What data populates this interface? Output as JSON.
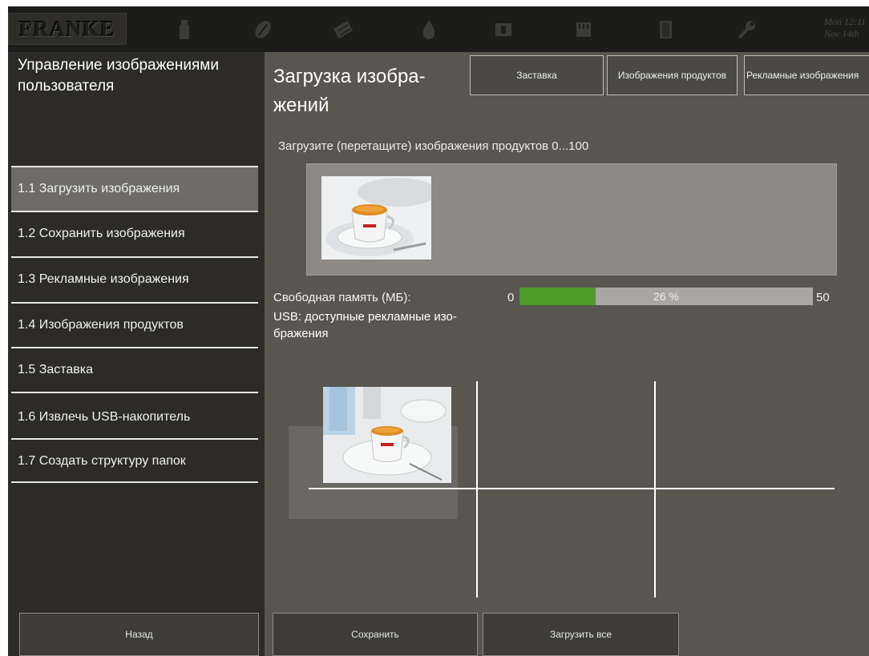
{
  "header": {
    "logo_text": "FRANKE",
    "icons": [
      "product-bag-icon",
      "coffee-bean-icon",
      "chocolate-icon",
      "water-drop-icon",
      "cup-icon",
      "cup-holder-icon",
      "door-icon",
      "wrench-icon"
    ],
    "datetime_line1": "Mon 12:11",
    "datetime_line2": "Nov 14th"
  },
  "sidebar": {
    "title": "Управление изображениями пользователя",
    "items": [
      {
        "label": "1.1 Загрузить изображения",
        "active": true
      },
      {
        "label": "1.2 Сохранить изображения",
        "active": false
      },
      {
        "label": "1.3 Рекламные изображения",
        "active": false
      },
      {
        "label": "1.4 Изображения продуктов",
        "active": false
      },
      {
        "label": "1.5 Заставка",
        "active": false
      },
      {
        "label": "1.6 Извлечь USB-накопитель",
        "active": false
      },
      {
        "label": "1.7 Создать структуру папок",
        "active": false
      }
    ],
    "back_label": "Назад"
  },
  "main": {
    "title_line1": "Загрузка изобра-",
    "title_line2": "жений",
    "tabs": [
      {
        "label": "Заставка"
      },
      {
        "label": "Изображения продуктов"
      },
      {
        "label": "Рекламные изображения"
      }
    ],
    "hint": "Загрузите (перетащите) изображения продуктов 0...100",
    "memory": {
      "label": "Свободная память (МБ):",
      "min": "0",
      "max": "50",
      "percent_text": "26 %",
      "fill_fraction": 0.26
    },
    "usb_label_line1": "USB: доступные рекламные изо-",
    "usb_label_line2": "бражения",
    "save_label": "Сохранить",
    "load_all_label": "Загрузить все"
  },
  "colors": {
    "topbar": "#1c1c1a",
    "sidebar": "#2c2b28",
    "main_bg": "#58564f",
    "active_item": "#6e6c68",
    "progress_fill": "#4f9b2b",
    "progress_track": "#a9a7a3"
  }
}
